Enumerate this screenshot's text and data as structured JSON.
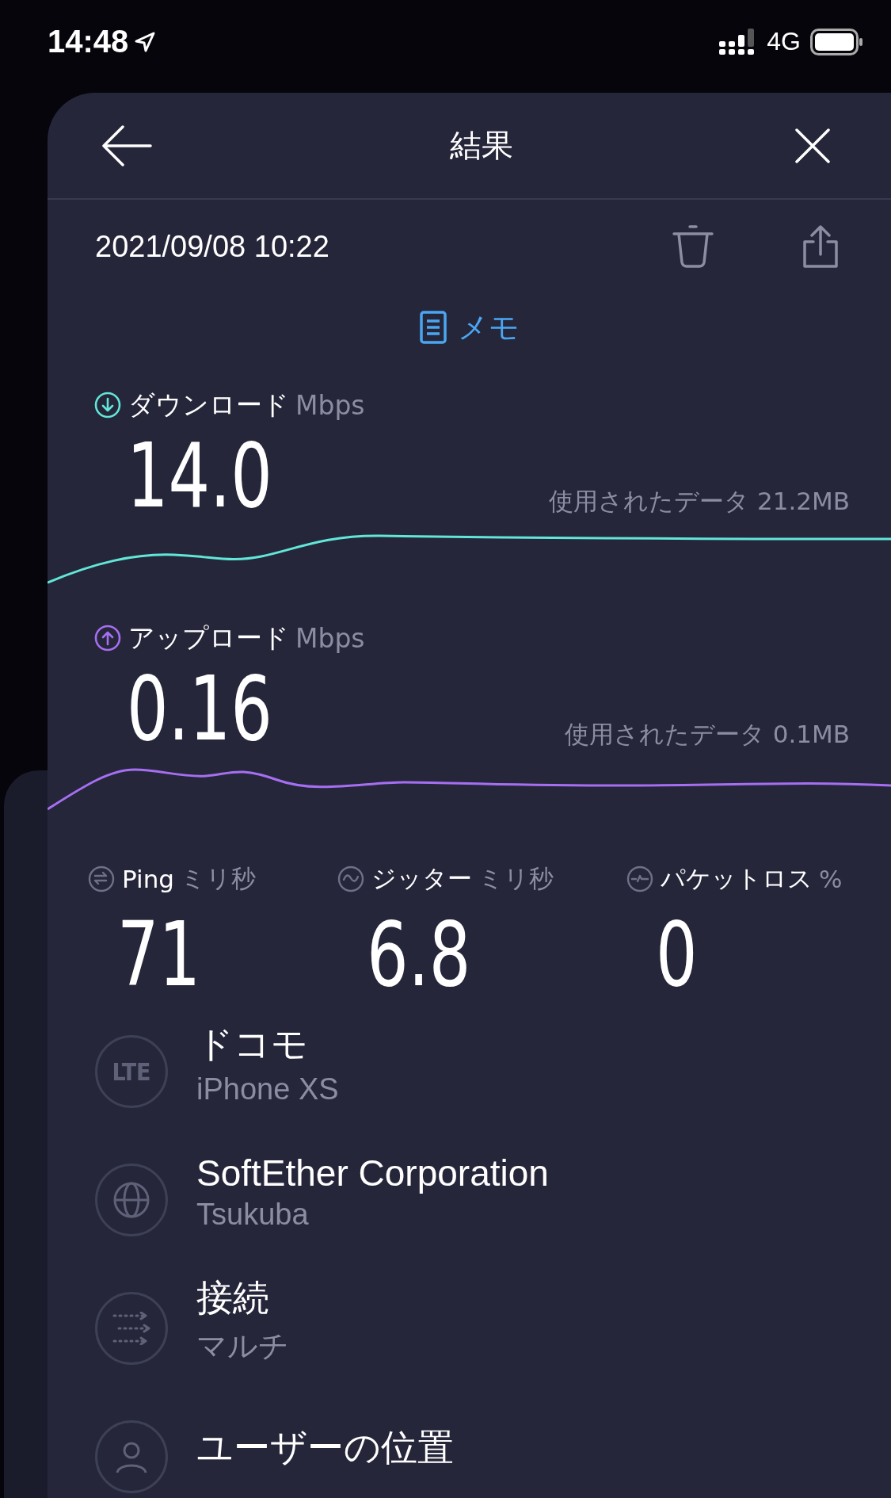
{
  "status_bar": {
    "time": "14:48",
    "network": "4G"
  },
  "header": {
    "title": "結果"
  },
  "result": {
    "date": "2021/09/08 10:22",
    "memo": "メモ"
  },
  "speeds": [
    {
      "kind": "download",
      "label": "ダウンロード",
      "unit": "Mbps",
      "value": "14.0",
      "data_used": "使用されたデータ 21.2MB",
      "color": "#62e6d8"
    },
    {
      "kind": "upload",
      "label": "アップロード",
      "unit": "Mbps",
      "value": "0.16",
      "data_used": "使用されたデータ 0.1MB",
      "color": "#a66ff2"
    }
  ],
  "metrics": [
    {
      "kind": "ping",
      "label": "Ping",
      "unit": "ミリ秒",
      "value": "71"
    },
    {
      "kind": "jitter",
      "label": "ジッター",
      "unit": "ミリ秒",
      "value": "6.8"
    },
    {
      "kind": "packet_loss",
      "label": "パケットロス",
      "unit": "%",
      "value": "0"
    }
  ],
  "details": [
    {
      "kind": "carrier",
      "icon_text": "LTE",
      "title": "ドコモ",
      "subtitle": "iPhone XS"
    },
    {
      "kind": "server",
      "title": "SoftEther Corporation",
      "subtitle": "Tsukuba"
    },
    {
      "kind": "connection",
      "title": "接続",
      "subtitle": "マルチ"
    },
    {
      "kind": "location",
      "title": "ユーザーの位置"
    }
  ]
}
